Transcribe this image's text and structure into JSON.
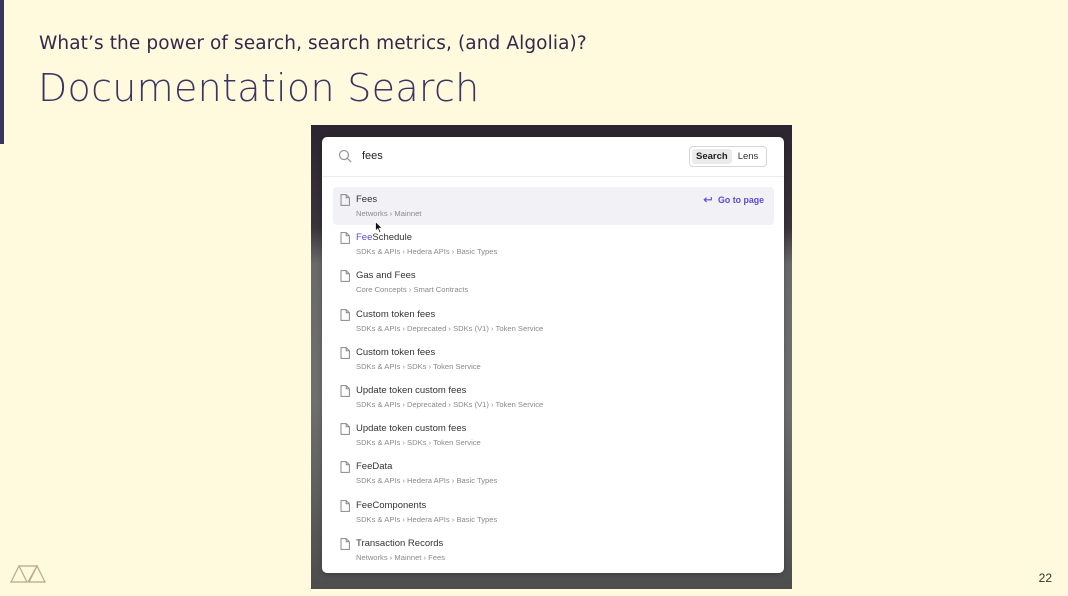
{
  "slide": {
    "subtitle": "What’s the power of search, search metrics, (and Algolia)?",
    "title": "Documentation Search",
    "page_number": "22"
  },
  "search": {
    "query": "fees",
    "modes": [
      "Search",
      "Lens"
    ],
    "active_mode": "Search"
  },
  "results": [
    {
      "title": "Fees",
      "path": "Networks › Mainnet",
      "selected": true,
      "action": "Go to page"
    },
    {
      "title_highlight": "Fee",
      "title_rest": "Schedule",
      "path": "SDKs & APIs › Hedera APIs › Basic Types"
    },
    {
      "title": "Gas and Fees",
      "path": "Core Concepts › Smart Contracts"
    },
    {
      "title": "Custom token fees",
      "path": "SDKs & APIs › Deprecated › SDKs (V1) › Token Service"
    },
    {
      "title": "Custom token fees",
      "path": "SDKs & APIs › SDKs › Token Service"
    },
    {
      "title": "Update token custom fees",
      "path": "SDKs & APIs › Deprecated › SDKs (V1) › Token Service"
    },
    {
      "title": "Update token custom fees",
      "path": "SDKs & APIs › SDKs › Token Service"
    },
    {
      "title": "FeeData",
      "path": "SDKs & APIs › Hedera APIs › Basic Types"
    },
    {
      "title": "FeeComponents",
      "path": "SDKs & APIs › Hedera APIs › Basic Types"
    },
    {
      "title": "Transaction Records",
      "path": "Networks › Mainnet › Fees"
    }
  ],
  "colors": {
    "background": "#fff9de",
    "title": "#3a3560",
    "accent": "#5a48d8"
  },
  "icons": {
    "search": "search-icon",
    "document": "document-icon",
    "go_to_page": "return-arrow-icon",
    "logo": "triangles-logo-icon"
  }
}
